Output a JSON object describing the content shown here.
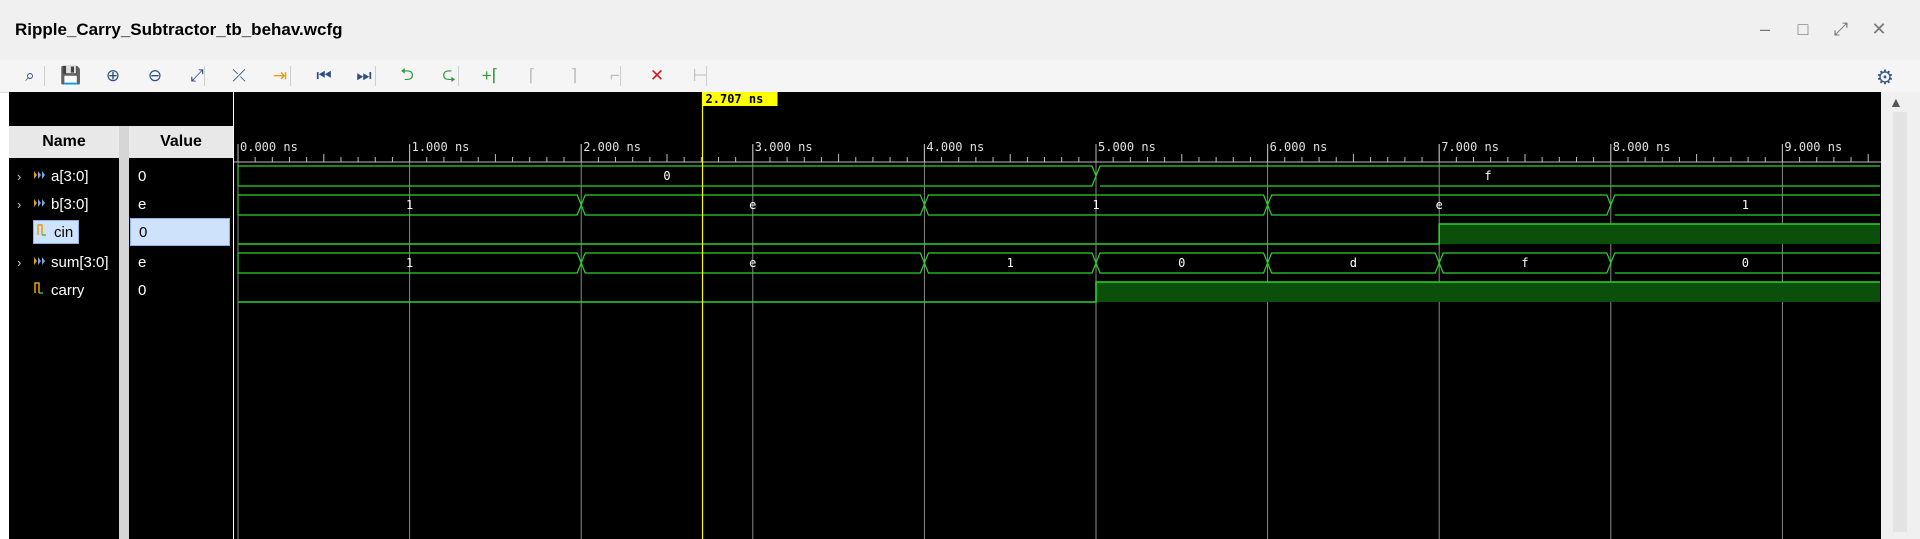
{
  "window": {
    "title": "Ripple_Carry_Subtractor_tb_behav.wcfg"
  },
  "toolbar": {
    "buttons": [
      {
        "name": "search-button",
        "icon": "search-icon",
        "glyph": "⌕",
        "color": "#2d4f80",
        "disabled": false
      },
      {
        "name": "save-button",
        "icon": "save-icon",
        "glyph": "💾",
        "color": "#2d4f80",
        "disabled": false
      },
      {
        "name": "zoom-in-button",
        "icon": "zoom-in-icon",
        "glyph": "⊕",
        "color": "#2d4f80",
        "disabled": false
      },
      {
        "name": "zoom-out-button",
        "icon": "zoom-out-icon",
        "glyph": "⊖",
        "color": "#2d4f80",
        "disabled": false
      },
      {
        "name": "zoom-fit-button",
        "icon": "zoom-fit-icon",
        "glyph": "⤢",
        "color": "#2d4f80",
        "disabled": false
      },
      {
        "name": "cursor-to-zero-button",
        "icon": "cursor-icon",
        "glyph": "⤫",
        "color": "#2d4f80",
        "disabled": false
      },
      {
        "name": "go-to-time-zero-button",
        "icon": "goto-zero-icon",
        "glyph": "⇥",
        "color": "#e5a00d",
        "disabled": false
      },
      {
        "name": "go-to-start-button",
        "icon": "skip-start-icon",
        "glyph": "⏮",
        "color": "#2d4f80",
        "disabled": false
      },
      {
        "name": "go-to-end-button",
        "icon": "skip-end-icon",
        "glyph": "⏭",
        "color": "#2d4f80",
        "disabled": false
      },
      {
        "name": "previous-transition-button",
        "icon": "prev-transition-icon",
        "glyph": "⮌",
        "color": "#2e9a3a",
        "disabled": false
      },
      {
        "name": "next-transition-button",
        "icon": "next-transition-icon",
        "glyph": "⮎",
        "color": "#2e9a3a",
        "disabled": false
      },
      {
        "name": "add-marker-button",
        "icon": "add-marker-icon",
        "glyph": "+⌈",
        "color": "#2e9a3a",
        "disabled": false
      },
      {
        "name": "previous-marker-button",
        "icon": "prev-marker-icon",
        "glyph": "⌈",
        "color": "#bdbdbd",
        "disabled": true
      },
      {
        "name": "next-marker-button",
        "icon": "next-marker-icon",
        "glyph": "⌉",
        "color": "#bdbdbd",
        "disabled": true
      },
      {
        "name": "swap-cursors-button",
        "icon": "swap-cursor-icon",
        "glyph": "⌐",
        "color": "#bdbdbd",
        "disabled": true
      },
      {
        "name": "delete-markers-button",
        "icon": "close-icon",
        "glyph": "✕",
        "color": "#d61a1a",
        "disabled": false
      },
      {
        "name": "snap-to-transition-button",
        "icon": "snap-icon",
        "glyph": "⊢",
        "color": "#bdbdbd",
        "disabled": true
      }
    ]
  },
  "columns": {
    "name": "Name",
    "value": "Value"
  },
  "signals": [
    {
      "name": "a[3:0]",
      "value": "0",
      "type": "bus",
      "expandable": true,
      "selected": false
    },
    {
      "name": "b[3:0]",
      "value": "e",
      "type": "bus",
      "expandable": true,
      "selected": false
    },
    {
      "name": "cin",
      "value": "0",
      "type": "bit",
      "expandable": false,
      "selected": true
    },
    {
      "name": "sum[3:0]",
      "value": "e",
      "type": "bus",
      "expandable": true,
      "selected": false
    },
    {
      "name": "carry",
      "value": "0",
      "type": "bit",
      "expandable": false,
      "selected": false
    }
  ],
  "cursor": {
    "time_ns": 2.707,
    "label": "2.707 ns"
  },
  "timeline": {
    "start_ns": 0,
    "end_ns": 9.6,
    "ticks": [
      "0.000 ns",
      "1.000 ns",
      "2.000 ns",
      "3.000 ns",
      "4.000 ns",
      "5.000 ns",
      "6.000 ns",
      "7.000 ns",
      "8.000 ns",
      "9.000 ns"
    ]
  },
  "waves": [
    {
      "signal": "a[3:0]",
      "type": "bus",
      "segments": [
        {
          "start": 0,
          "end": 5,
          "label": "0"
        },
        {
          "start": 5,
          "end": 9.6,
          "label": "f"
        }
      ]
    },
    {
      "signal": "b[3:0]",
      "type": "bus",
      "segments": [
        {
          "start": 0,
          "end": 2,
          "label": "1"
        },
        {
          "start": 2,
          "end": 4,
          "label": "e"
        },
        {
          "start": 4,
          "end": 6,
          "label": "1"
        },
        {
          "start": 6,
          "end": 8,
          "label": "e"
        },
        {
          "start": 8,
          "end": 9.6,
          "label": "1"
        }
      ]
    },
    {
      "signal": "cin",
      "type": "bit",
      "segments": [
        {
          "start": 0,
          "end": 7,
          "level": 0
        },
        {
          "start": 7,
          "end": 9.6,
          "level": 1
        }
      ]
    },
    {
      "signal": "sum[3:0]",
      "type": "bus",
      "segments": [
        {
          "start": 0,
          "end": 2,
          "label": "1"
        },
        {
          "start": 2,
          "end": 4,
          "label": "e"
        },
        {
          "start": 4,
          "end": 5,
          "label": "1"
        },
        {
          "start": 5,
          "end": 6,
          "label": "0"
        },
        {
          "start": 6,
          "end": 7,
          "label": "d"
        },
        {
          "start": 7,
          "end": 8,
          "label": "f"
        },
        {
          "start": 8,
          "end": 9.6,
          "label": "0"
        }
      ]
    },
    {
      "signal": "carry",
      "type": "bit",
      "segments": [
        {
          "start": 0,
          "end": 5,
          "level": 0
        },
        {
          "start": 5,
          "end": 9.6,
          "level": 1
        }
      ]
    }
  ],
  "colors": {
    "wave": "#28d428",
    "wave_fill": "#0b4f0b",
    "cursor": "#ffff00",
    "grid": "#bdbdbd"
  }
}
